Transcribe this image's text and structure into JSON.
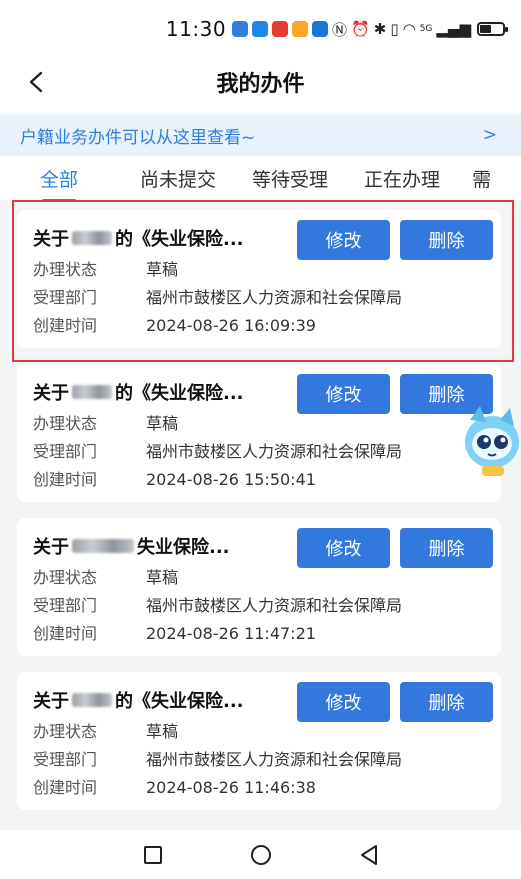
{
  "status_bar": {
    "time": "11:30",
    "network": "5G"
  },
  "header": {
    "title": "我的办件"
  },
  "notice": {
    "text": "户籍业务办件可以从这里查看~",
    "arrow": ">"
  },
  "tabs": [
    {
      "label": "全部",
      "active": true
    },
    {
      "label": "尚未提交",
      "active": false
    },
    {
      "label": "等待受理",
      "active": false
    },
    {
      "label": "正在办理",
      "active": false
    },
    {
      "label": "需",
      "active": false
    }
  ],
  "labels": {
    "status": "办理状态",
    "department": "受理部门",
    "created": "创建时间",
    "edit": "修改",
    "delete": "删除"
  },
  "cards": [
    {
      "title_prefix": "关于",
      "title_suffix": "的《失业保险...",
      "status": "草稿",
      "department": "福州市鼓楼区人力资源和社会保障局",
      "created": "2024-08-26 16:09:39"
    },
    {
      "title_prefix": "关于",
      "title_suffix": "的《失业保险...",
      "status": "草稿",
      "department": "福州市鼓楼区人力资源和社会保障局",
      "created": "2024-08-26 15:50:41"
    },
    {
      "title_prefix": "关于",
      "title_suffix": "失业保险...",
      "status": "草稿",
      "department": "福州市鼓楼区人力资源和社会保障局",
      "created": "2024-08-26 11:47:21"
    },
    {
      "title_prefix": "关于",
      "title_suffix": "的《失业保险...",
      "status": "草稿",
      "department": "福州市鼓楼区人力资源和社会保障局",
      "created": "2024-08-26 11:46:38"
    }
  ],
  "colors": {
    "accent": "#3278dd",
    "notice_bg": "#e7f2fc",
    "highlight": "#e53935"
  }
}
